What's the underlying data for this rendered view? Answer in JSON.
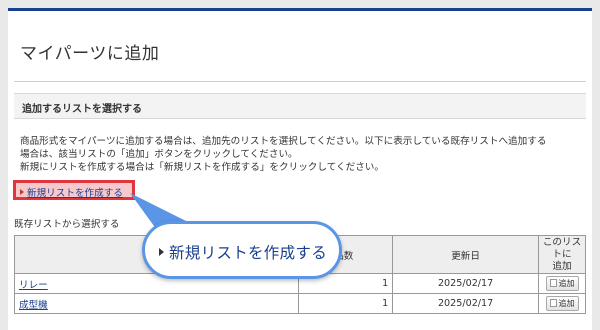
{
  "page": {
    "title": "マイパーツに追加"
  },
  "section": {
    "title": "追加するリストを選択する"
  },
  "description": {
    "line1": "商品形式をマイパーツに追加する場合は、追加先のリストを選択してください。以下に表示している既存リストへ追加する",
    "line2": "場合は、該当リストの「追加」ボタンをクリックしてください。",
    "line3": "新規にリストを作成する場合は「新規リストを作成する」をクリックしてください。"
  },
  "new_list_link": {
    "label": "新規リストを作成する"
  },
  "existing": {
    "label": "既存リストから選択する"
  },
  "table": {
    "headers": {
      "name": "",
      "count": "品数",
      "updated": "更新日",
      "add_line1": "このリストに",
      "add_line2": "追加"
    },
    "rows": [
      {
        "name": "リレー",
        "count": "1",
        "updated": "2025/02/17",
        "add": "追加"
      },
      {
        "name": "成型機",
        "count": "1",
        "updated": "2025/02/17",
        "add": "追加"
      }
    ]
  },
  "callout": {
    "label": "新規リストを作成する"
  },
  "colors": {
    "accent": "#1a3f8f",
    "highlight_border": "#e0353d",
    "highlight_fill": "#f6c9cd",
    "callout_border": "#5b95e6"
  }
}
